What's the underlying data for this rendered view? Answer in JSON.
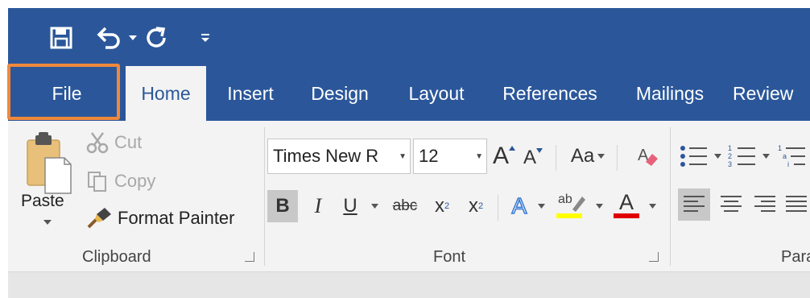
{
  "quick_access": {
    "save_icon": "save-icon",
    "undo_icon": "undo-icon",
    "redo_icon": "redo-icon",
    "customize_icon": "customize-qat-icon"
  },
  "tabs": [
    {
      "label": "File"
    },
    {
      "label": "Home"
    },
    {
      "label": "Insert"
    },
    {
      "label": "Design"
    },
    {
      "label": "Layout"
    },
    {
      "label": "References"
    },
    {
      "label": "Mailings"
    },
    {
      "label": "Review"
    }
  ],
  "clipboard": {
    "paste_label": "Paste",
    "cut_label": "Cut",
    "copy_label": "Copy",
    "format_painter_label": "Format Painter",
    "group_label": "Clipboard"
  },
  "font": {
    "font_name": "Times New R",
    "font_size": "12",
    "change_case_label": "Aa",
    "bold_label": "B",
    "italic_label": "I",
    "underline_label": "U",
    "strikethrough_label": "abc",
    "subscript_label": "x",
    "subscript_mark": "2",
    "superscript_label": "x",
    "superscript_mark": "2",
    "grow_label": "A",
    "shrink_label": "A",
    "text_effects_label": "A",
    "highlight_label": "ab",
    "font_color_label": "A",
    "group_label": "Font",
    "highlight_color": "#ffff00",
    "font_color": "#e00000"
  },
  "paragraph": {
    "group_label": "Para"
  },
  "colors": {
    "ribbon_blue": "#2b579a",
    "highlight_border": "#f0883a"
  }
}
